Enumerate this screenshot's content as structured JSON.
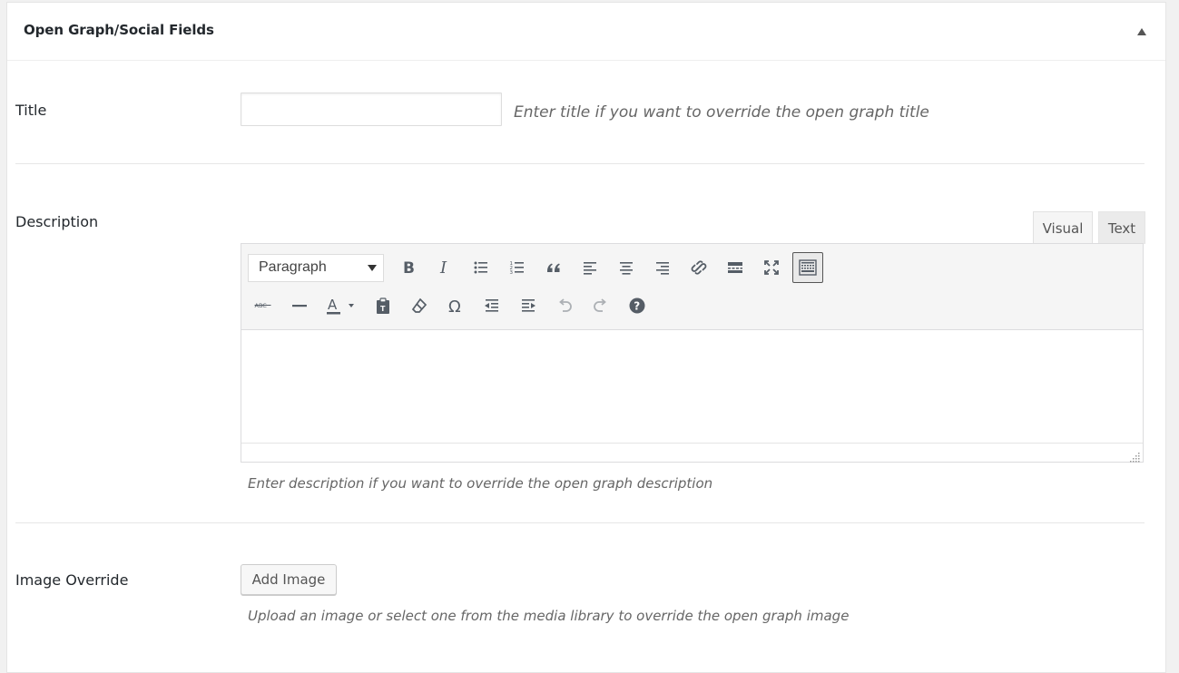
{
  "panel": {
    "title": "Open Graph/Social Fields"
  },
  "fields": {
    "title": {
      "label": "Title",
      "value": "",
      "placeholder": "",
      "hint": "Enter title if you want to override the open graph title"
    },
    "description": {
      "label": "Description",
      "hint": "Enter description if you want to override the open graph description",
      "tabs": [
        {
          "label": "Visual",
          "active": true
        },
        {
          "label": "Text",
          "active": false
        }
      ],
      "format_select": "Paragraph",
      "toolbar_row1": [
        "bold-icon",
        "italic-icon",
        "bullet-list-icon",
        "numbered-list-icon",
        "blockquote-icon",
        "align-left-icon",
        "align-center-icon",
        "align-right-icon",
        "link-icon",
        "read-more-icon",
        "fullscreen-icon",
        "toolbar-toggle-icon"
      ],
      "toolbar_row2": [
        "strikethrough-icon",
        "horizontal-line-icon",
        "text-color-icon",
        "paste-as-text-icon",
        "clear-formatting-icon",
        "special-character-icon",
        "outdent-icon",
        "indent-icon",
        "undo-icon",
        "redo-icon",
        "help-icon"
      ]
    },
    "image_override": {
      "label": "Image Override",
      "button_label": "Add Image",
      "hint": "Upload an image or select one from the media library to override the open graph image"
    }
  },
  "colors": {
    "icon": "#555d66",
    "text": "#23282d",
    "hint": "#666666"
  }
}
